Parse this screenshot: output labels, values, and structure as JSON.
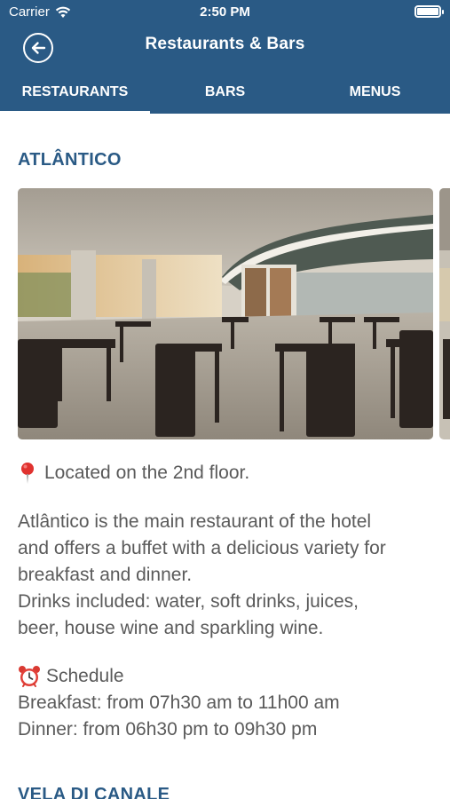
{
  "status_bar": {
    "carrier": "Carrier",
    "time": "2:50 PM"
  },
  "header": {
    "title": "Restaurants & Bars",
    "back_icon": "arrow-left-circle-icon"
  },
  "tabs": [
    {
      "label": "RESTAURANTS",
      "active": true
    },
    {
      "label": "BARS",
      "active": false
    },
    {
      "label": "MENUS",
      "active": false
    }
  ],
  "restaurant": {
    "name": "ATLÂNTICO",
    "location": "Located on the 2nd floor.",
    "description": [
      "Atlântico is the main restaurant of the hotel",
      "and offers a buffet with a delicious variety for",
      "breakfast and dinner.",
      "Drinks included: water, soft drinks, juices,",
      "beer, house wine and sparkling wine."
    ],
    "schedule": {
      "heading": "Schedule",
      "breakfast": "Breakfast: from 07h30 am to 11h00 am",
      "dinner": "Dinner: from 06h30 pm to 09h30 pm"
    }
  },
  "next_restaurant": {
    "name": "VELA DI CANALE"
  },
  "colors": {
    "brand": "#2a5a85",
    "text": "#5a5a5a",
    "background": "#ffffff"
  }
}
